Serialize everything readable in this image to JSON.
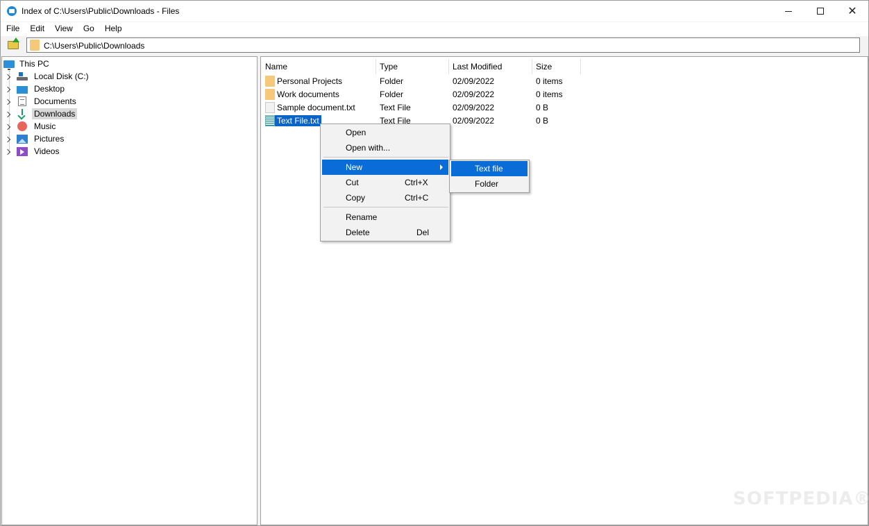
{
  "window": {
    "title": "Index of C:\\Users\\Public\\Downloads - Files",
    "controls": {
      "minimize": "",
      "maximize": "",
      "close": "✕"
    }
  },
  "menubar": [
    "File",
    "Edit",
    "View",
    "Go",
    "Help"
  ],
  "address": {
    "path": "C:\\Users\\Public\\Downloads"
  },
  "tree": {
    "root": "This PC",
    "items": [
      {
        "label": "Local Disk (C:)",
        "icon": "local-disk-icon"
      },
      {
        "label": "Desktop",
        "icon": "desktop-icon"
      },
      {
        "label": "Documents",
        "icon": "documents-icon"
      },
      {
        "label": "Downloads",
        "icon": "downloads-icon",
        "selected": true
      },
      {
        "label": "Music",
        "icon": "music-icon"
      },
      {
        "label": "Pictures",
        "icon": "pictures-icon"
      },
      {
        "label": "Videos",
        "icon": "videos-icon"
      }
    ]
  },
  "list": {
    "columns": [
      "Name",
      "Type",
      "Last Modified",
      "Size"
    ],
    "rows": [
      {
        "name": "Personal Projects",
        "type": "Folder",
        "modified": "02/09/2022",
        "size": "0 items",
        "icon": "folder-icon"
      },
      {
        "name": "Work documents",
        "type": "Folder",
        "modified": "02/09/2022",
        "size": "0 items",
        "icon": "folder-icon"
      },
      {
        "name": "Sample document.txt",
        "type": "Text File",
        "modified": "02/09/2022",
        "size": "0 B",
        "icon": "file-icon"
      },
      {
        "name": "Text File.txt",
        "type": "Text File",
        "modified": "02/09/2022",
        "size": "0 B",
        "icon": "text-file-icon",
        "selected": true
      }
    ]
  },
  "context_menu": {
    "items": [
      {
        "label": "Open",
        "shortcut": ""
      },
      {
        "label": "Open with...",
        "shortcut": ""
      },
      {
        "label": "New",
        "shortcut": "",
        "highlighted": true,
        "submenu": true
      },
      {
        "label": "Cut",
        "shortcut": "Ctrl+X"
      },
      {
        "label": "Copy",
        "shortcut": "Ctrl+C"
      },
      {
        "label": "Rename",
        "shortcut": ""
      },
      {
        "label": "Delete",
        "shortcut": "Del"
      }
    ]
  },
  "submenu": {
    "items": [
      {
        "label": "Text file",
        "highlighted": true
      },
      {
        "label": "Folder"
      }
    ]
  },
  "watermark": "SOFTPEDIA®",
  "colors": {
    "accent": "#0a6cd6",
    "selection": "#0a64c8"
  }
}
